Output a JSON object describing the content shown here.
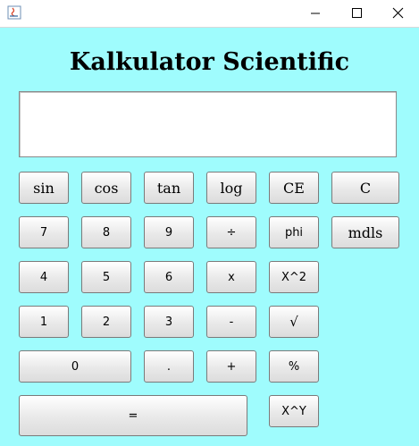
{
  "app": {
    "title": "Kalkulator Scientific",
    "display_value": ""
  },
  "window_controls": {
    "minimize_icon": "minimize-icon",
    "maximize_icon": "maximize-icon",
    "close_icon": "close-icon"
  },
  "buttons": {
    "sin": "sin",
    "cos": "cos",
    "tan": "tan",
    "log": "log",
    "ce": "CE",
    "c": "C",
    "n7": "7",
    "n8": "8",
    "n9": "9",
    "divide": "÷",
    "phi": "phi",
    "mdls": "mdls",
    "n4": "4",
    "n5": "5",
    "n6": "6",
    "multiply": "x",
    "square": "X^2",
    "n1": "1",
    "n2": "2",
    "n3": "3",
    "minus": "-",
    "sqrt": "√",
    "n0": "0",
    "dot": ".",
    "plus": "+",
    "percent": "%",
    "equals": "=",
    "power": "X^Y"
  },
  "colors": {
    "background": "#9ffcfd"
  }
}
